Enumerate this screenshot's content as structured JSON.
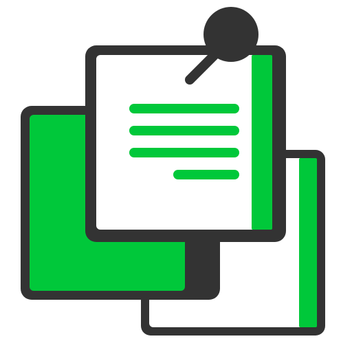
{
  "icon": {
    "name": "pinned-documents-icon",
    "colors": {
      "outline": "#333333",
      "accent": "#00c83a",
      "paper": "#ffffff"
    }
  }
}
